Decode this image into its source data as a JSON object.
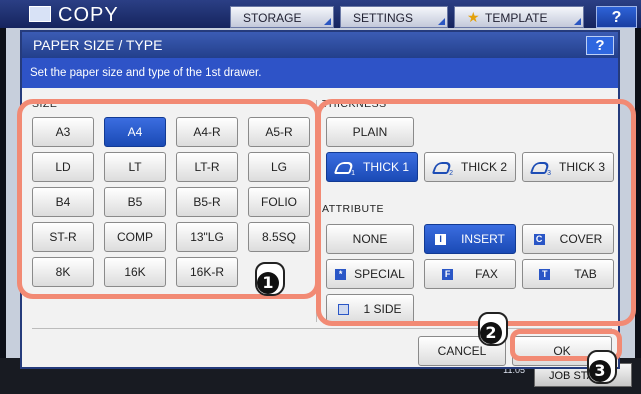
{
  "app": {
    "title": "COPY"
  },
  "topbar": {
    "storage_label": "STORAGE",
    "settings_label": "SETTINGS",
    "template_label": "TEMPLATE",
    "help_label": "?"
  },
  "dialog": {
    "title": "PAPER SIZE / TYPE",
    "help_label": "?",
    "instruction": "Set the paper size and type of the 1st drawer."
  },
  "size": {
    "section_label": "SIZE",
    "selected": "A4",
    "rows": [
      [
        "A3",
        "A4",
        "A4-R",
        "A5-R"
      ],
      [
        "LD",
        "LT",
        "LT-R",
        "LG"
      ],
      [
        "B4",
        "B5",
        "B5-R",
        "FOLIO"
      ],
      [
        "ST-R",
        "COMP",
        "13\"LG",
        "8.5SQ"
      ],
      [
        "8K",
        "16K",
        "16K-R"
      ]
    ]
  },
  "thickness": {
    "section_label": "THICKNESS",
    "plain": "PLAIN",
    "thick1": "THICK 1",
    "thick2": "THICK 2",
    "thick3": "THICK 3",
    "selected": "THICK 1"
  },
  "attribute": {
    "section_label": "ATTRIBUTE",
    "none": "NONE",
    "insert": "INSERT",
    "cover": "COVER",
    "special": "SPECIAL",
    "fax": "FAX",
    "tab": "TAB",
    "one_side": "1 SIDE",
    "selected": "INSERT",
    "icons": {
      "insert": "I",
      "cover": "C",
      "special": "*",
      "fax": "F",
      "tab": "T"
    }
  },
  "actions": {
    "cancel_label": "CANCEL",
    "ok_label": "OK"
  },
  "statusbar": {
    "clock": "11:05",
    "job_label": "JOB STATUS"
  },
  "callouts": [
    "1",
    "2",
    "3"
  ],
  "colors": {
    "accent": "#1a4ab5",
    "frame": "#f28a74",
    "header": "#2e53c7"
  }
}
